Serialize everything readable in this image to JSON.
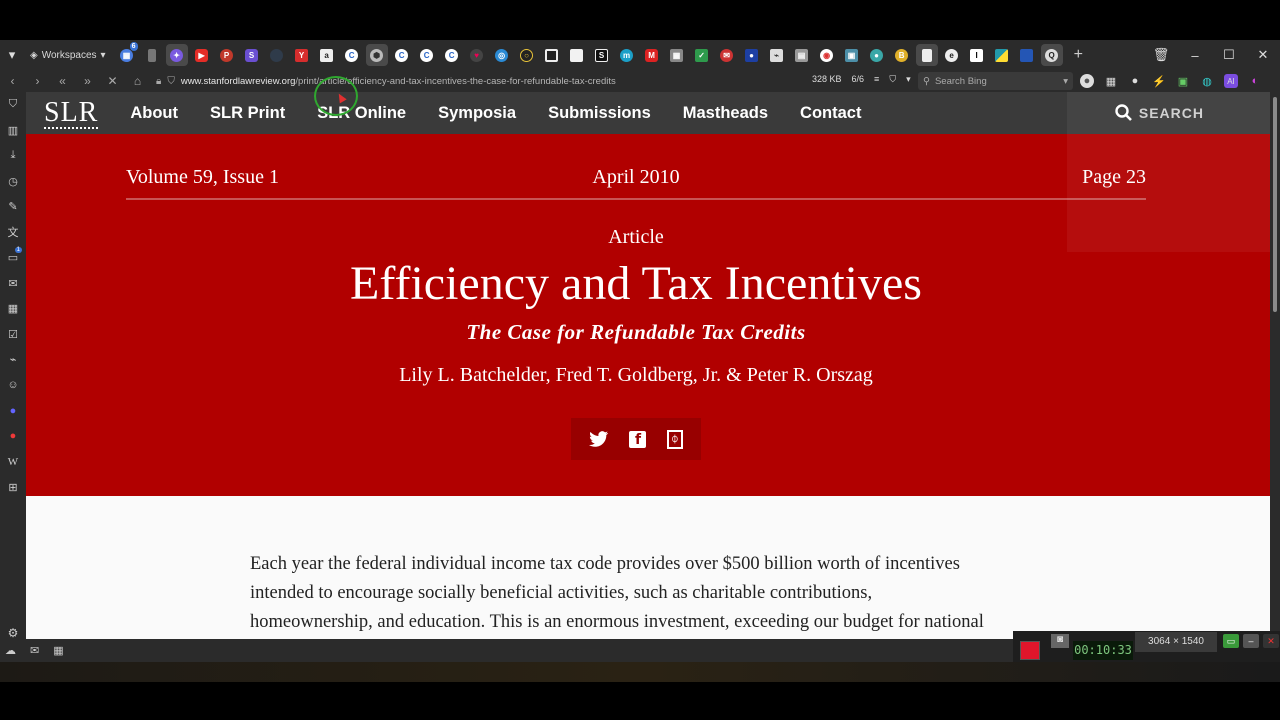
{
  "browser": {
    "workspaces_label": "Workspaces",
    "tab_badge": "6",
    "tab_icons": [
      "grid",
      "doc",
      "puzzle",
      "youtube",
      "p",
      "s",
      "blank",
      "y",
      "a",
      "c",
      "stack",
      "c",
      "c",
      "c",
      "heart",
      "globe",
      "circle",
      "square",
      "white",
      "s",
      "m",
      "m",
      "grid",
      "check",
      "mail",
      "cbs",
      "tag",
      "folder",
      "chrome",
      "photo",
      "mic",
      "b",
      "doc",
      "edge",
      "i",
      "colors",
      "blue",
      "q"
    ],
    "new_tab": "+",
    "window_controls": [
      "🗑",
      "–",
      "☐",
      "✕"
    ],
    "url_domain": "www.stanfordlawreview.org",
    "url_path": "/print/article/efficiency-and-tax-incentives-the-case-for-refundable-tax-credits",
    "page_size": "328 KB",
    "page_count": "6/6",
    "search_placeholder": "Search Bing"
  },
  "side_panel_badge": "1",
  "site": {
    "logo": "SLR",
    "menu": [
      "About",
      "SLR Print",
      "SLR Online",
      "Symposia",
      "Submissions",
      "Mastheads",
      "Contact"
    ],
    "search_label": "SEARCH"
  },
  "article": {
    "volume": "Volume 59, Issue 1",
    "date": "April 2010",
    "page": "Page 23",
    "kicker": "Article",
    "title": "Efficiency and Tax Incentives",
    "subtitle": "The Case for Refundable Tax Credits",
    "authors": "Lily L. Batchelder, Fred T. Goldberg, Jr. & Peter R. Orszag",
    "share": [
      "twitter",
      "facebook",
      "pdf"
    ],
    "body_lines": [
      "Each year the federal individual income tax code provides over $500 billion worth of incentives",
      "intended to encourage socially beneficial activities, such as charitable contributions,",
      "homeownership, and education. This is an enormous investment, exceeding our budget for national"
    ]
  },
  "recorder": {
    "time": "00:10:33",
    "resolution": "3064 × 1540"
  }
}
